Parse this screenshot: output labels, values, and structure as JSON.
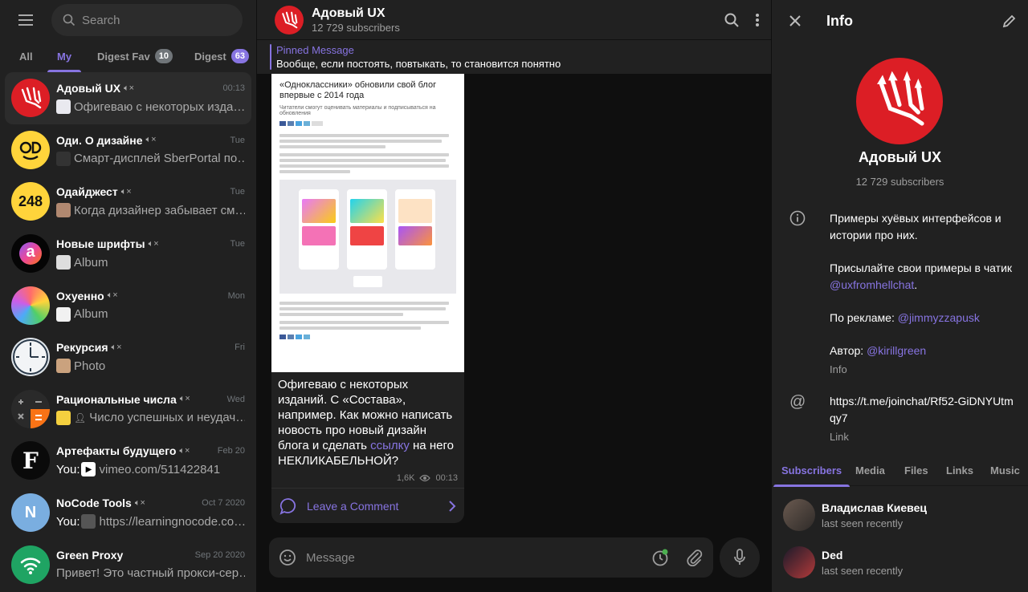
{
  "sidebar": {
    "search_placeholder": "Search",
    "folders": [
      {
        "label": "All",
        "badge": ""
      },
      {
        "label": "My",
        "badge": ""
      },
      {
        "label": "Digest Fav",
        "badge": "10"
      },
      {
        "label": "Digest",
        "badge": "63"
      }
    ],
    "chats": [
      {
        "name": "Адовый UX",
        "time": "00:13",
        "muted": true,
        "message": "Офигеваю с некоторых изда…",
        "you": "",
        "avatar": "trident-icon"
      },
      {
        "name": "Оди. О дизайне",
        "time": "Tue",
        "muted": true,
        "message": "Смарт-дисплей SberPortal по…",
        "you": "",
        "avatar": "od-logo"
      },
      {
        "name": "Одайджест",
        "time": "Tue",
        "muted": true,
        "message": "Когда дизайнер забывает см…",
        "you": "",
        "avatar": "248-logo",
        "avatar_text": "248"
      },
      {
        "name": "Новые шрифты",
        "time": "Tue",
        "muted": true,
        "message": "Album",
        "you": "",
        "avatar": "a-logo",
        "avatar_text": "a"
      },
      {
        "name": "Охуенно",
        "time": "Mon",
        "muted": true,
        "message": "Album",
        "you": "",
        "avatar": "gradient-circle"
      },
      {
        "name": "Рекурсия",
        "time": "Fri",
        "muted": true,
        "message": "Photo",
        "you": "",
        "avatar": "clock-icon"
      },
      {
        "name": "Рациональные числа",
        "time": "Wed",
        "muted": true,
        "message": "Число успешных и неудач…",
        "you": "",
        "avatar": "calculator-icon"
      },
      {
        "name": "Артефакты будущего",
        "time": "Feb 20",
        "muted": true,
        "message": "vimeo.com/511422841",
        "you": "You:",
        "avatar": "f-logo",
        "avatar_text": "F"
      },
      {
        "name": "NoCode Tools",
        "time": "Oct 7 2020",
        "muted": true,
        "message": "https://learningnocode.co…",
        "you": "You:",
        "avatar": "n-letter",
        "avatar_text": "N"
      },
      {
        "name": "Green Proxy",
        "time": "Sep 20 2020",
        "muted": false,
        "message": "Привет! Это частный прокси-сер…",
        "you": "",
        "avatar": "wifi-icon"
      }
    ]
  },
  "chat": {
    "title": "Адовый UX",
    "subscribers": "12 729 subscribers",
    "pinned_title": "Pinned Message",
    "pinned_text": "Вообще, если постоять, повтыкать, то становится понятно",
    "post": {
      "shot_title": "«Одноклассники» обновили свой блог впервые с 2014 года",
      "shot_lead": "Читатели смогут оценивать материалы и подписываться на обновления",
      "text_1": "Офигеваю с некоторых изданий. С «Состава», например. Как можно написать новость про новый дизайн блога и сделать ",
      "link": "ссылку",
      "text_2": " на него НЕКЛИКАБЕЛЬНОЙ?",
      "views": "1,6K",
      "time": "00:13",
      "comment_label": "Leave a Comment"
    },
    "composer_placeholder": "Message"
  },
  "info": {
    "header": "Info",
    "name": "Адовый UX",
    "subscribers": "12 729 subscribers",
    "description_1": "Примеры хуёвых интерфейсов и истории про них.",
    "description_2a": "Присылайте свои примеры в чатик ",
    "description_2b": "@uxfromhellchat",
    "description_2c": ".",
    "ads_label": "По рекламе: ",
    "ads_link": "@jimmyzzapusk",
    "author_label": "Автор: ",
    "author_link": "@kirillgreen",
    "info_caption": "Info",
    "link_value": "https://t.me/joinchat/Rf52-GiDNYUtmqy7",
    "link_caption": "Link",
    "tabs": [
      "Subscribers",
      "Media",
      "Files",
      "Links",
      "Music"
    ],
    "members": [
      {
        "name": "Владислав Киевец",
        "status": "last seen recently"
      },
      {
        "name": "Ded",
        "status": "last seen recently"
      }
    ]
  },
  "colors": {
    "accent": "#8774e1",
    "panel": "#212121",
    "background": "#0f0f0f",
    "channel_red": "#dc1e25"
  }
}
